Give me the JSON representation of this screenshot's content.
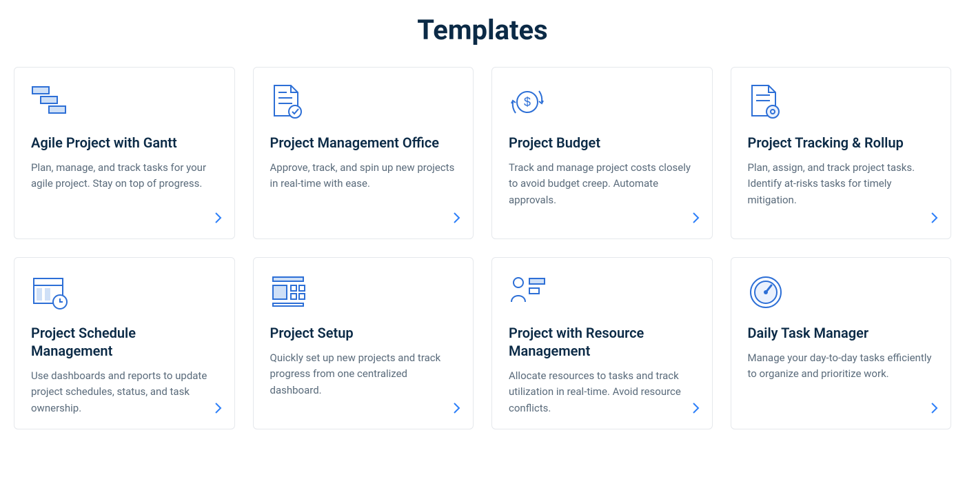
{
  "page_title": "Templates",
  "templates": [
    {
      "icon": "gantt-bars-icon",
      "title": "Agile Project with Gantt",
      "desc": "Plan, manage, and track tasks for your agile project. Stay on top of progress."
    },
    {
      "icon": "document-check-icon",
      "title": "Project Management Office",
      "desc": "Approve, track, and spin up new projects in real-time with ease."
    },
    {
      "icon": "budget-dollar-icon",
      "title": "Project Budget",
      "desc": "Track and manage project costs closely to avoid budget creep. Automate approvals."
    },
    {
      "icon": "document-eye-icon",
      "title": "Project Tracking & Rollup",
      "desc": "Plan, assign, and track project tasks. Identify at-risks tasks for timely mitigation."
    },
    {
      "icon": "calendar-clock-icon",
      "title": "Project Schedule Management",
      "desc": "Use dashboards and reports to update project schedules, status, and task ownership."
    },
    {
      "icon": "layout-grid-icon",
      "title": "Project Setup",
      "desc": "Quickly set up new projects and track progress from one centralized dashboard."
    },
    {
      "icon": "person-resource-icon",
      "title": "Project with Resource Management",
      "desc": "Allocate resources to tasks and track utilization in real-time. Avoid resource conflicts."
    },
    {
      "icon": "gauge-dial-icon",
      "title": "Daily Task Manager",
      "desc": "Manage your day-to-day tasks efficiently to organize and prioritize work."
    }
  ]
}
